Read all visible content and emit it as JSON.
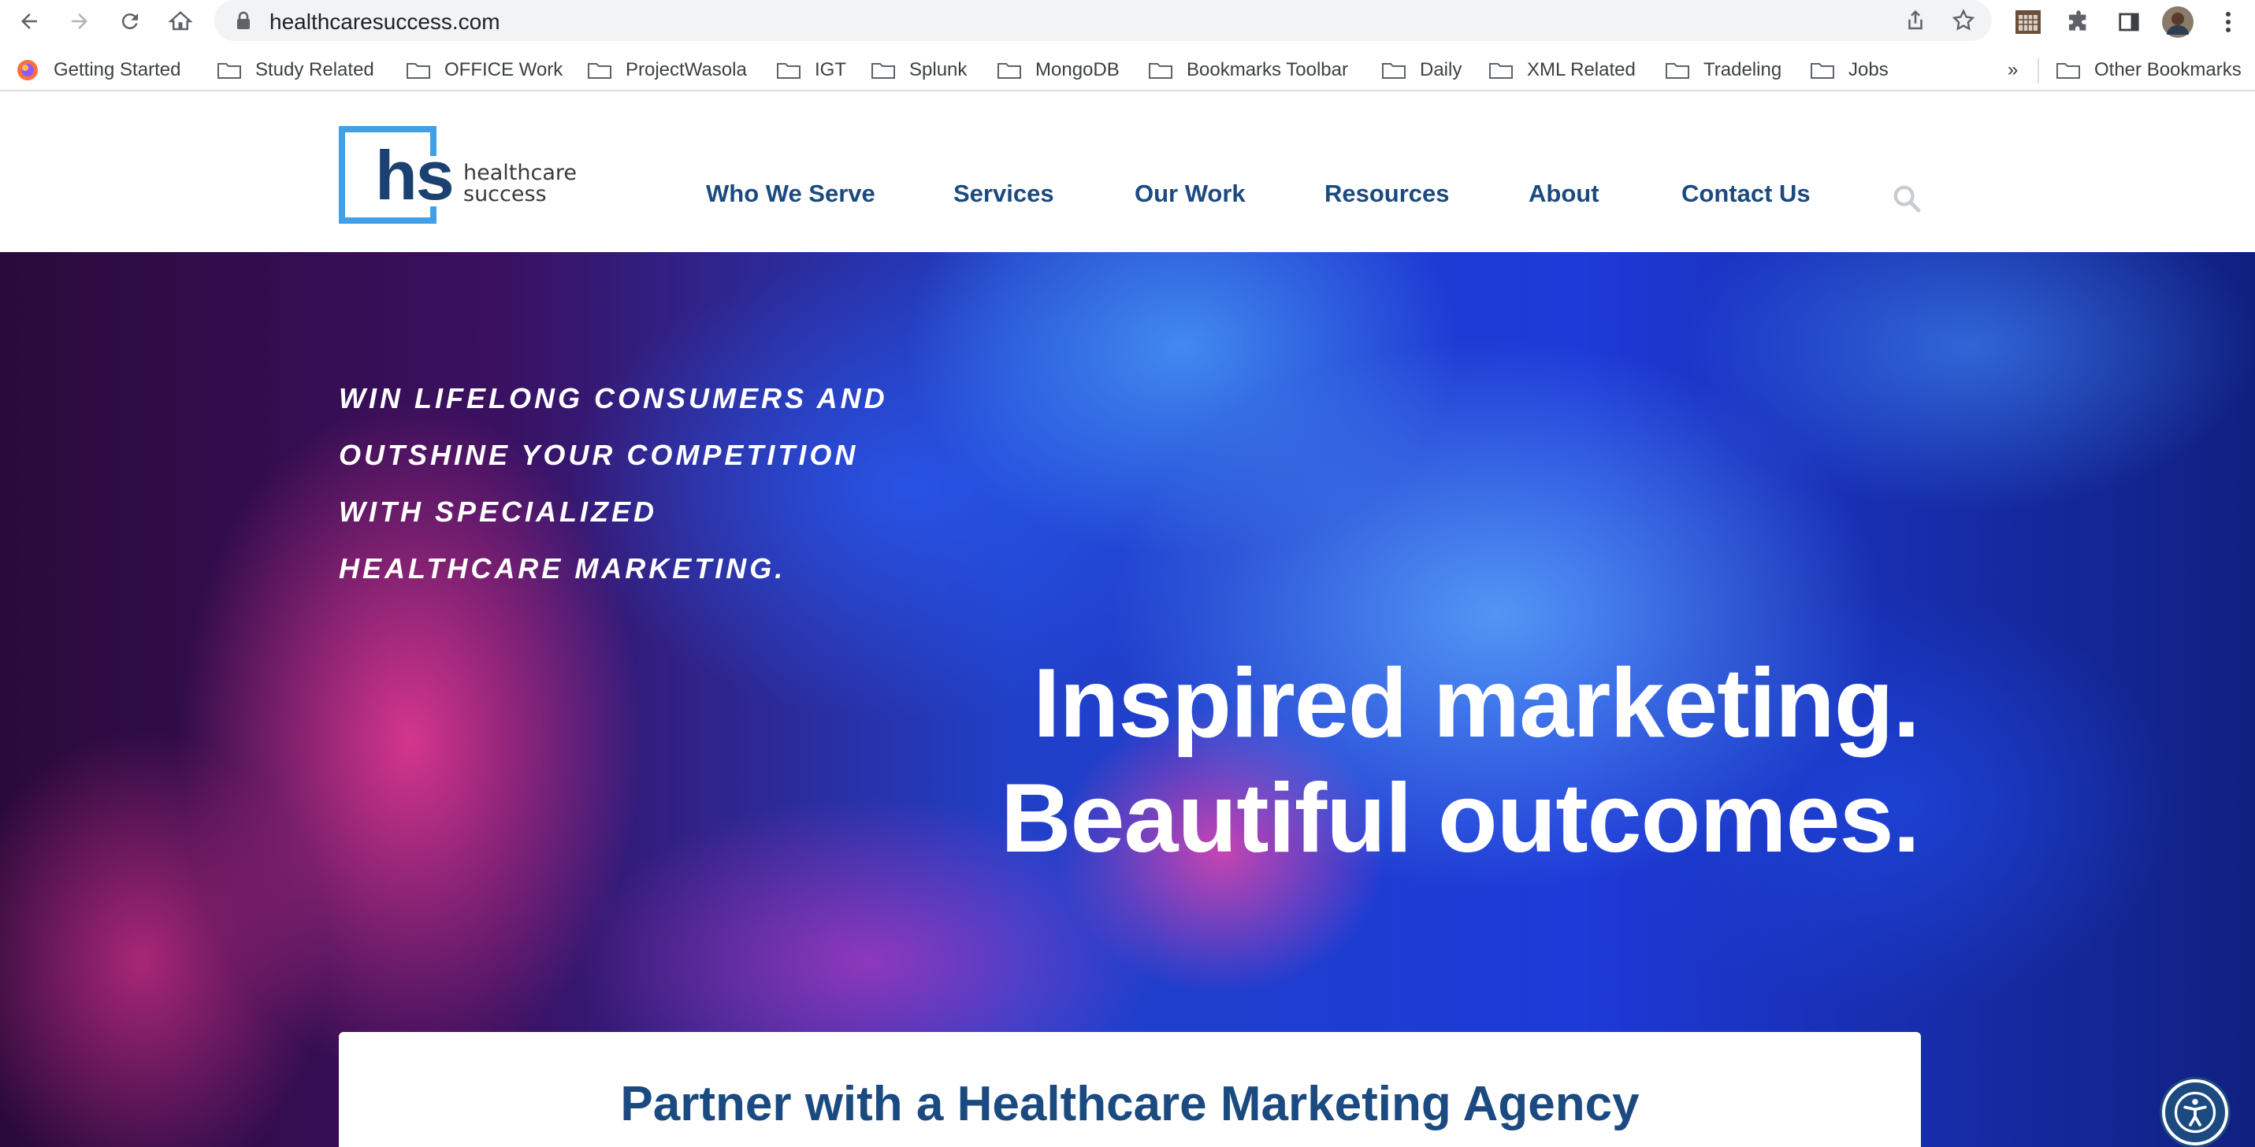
{
  "browser": {
    "url": "healthcaresuccess.com",
    "bookmarks": [
      {
        "label": "Getting Started",
        "icon": "firefox-icon"
      },
      {
        "label": "Study Related",
        "icon": "folder-icon"
      },
      {
        "label": "OFFICE Work",
        "icon": "folder-icon"
      },
      {
        "label": "ProjectWasola",
        "icon": "folder-icon"
      },
      {
        "label": "IGT",
        "icon": "folder-icon"
      },
      {
        "label": "Splunk",
        "icon": "folder-icon"
      },
      {
        "label": "MongoDB",
        "icon": "folder-icon"
      },
      {
        "label": "Bookmarks Toolbar",
        "icon": "folder-icon"
      },
      {
        "label": "Daily",
        "icon": "folder-icon"
      },
      {
        "label": "XML Related",
        "icon": "folder-icon"
      },
      {
        "label": "Tradeling",
        "icon": "folder-icon"
      },
      {
        "label": "Jobs",
        "icon": "folder-icon"
      }
    ],
    "overflow_label": "»",
    "other_bookmarks": "Other Bookmarks"
  },
  "site": {
    "logo": {
      "mark": "hs",
      "line1": "healthcare",
      "line2": "success"
    },
    "nav": [
      "Who We Serve",
      "Services",
      "Our Work",
      "Resources",
      "About",
      "Contact Us"
    ],
    "hero": {
      "tagline": [
        "WIN LIFELONG CONSUMERS AND",
        "OUTSHINE YOUR COMPETITION",
        "WITH SPECIALIZED",
        "HEALTHCARE MARKETING."
      ],
      "headline": [
        "Inspired marketing.",
        "Beautiful outcomes."
      ]
    },
    "partner_title": "Partner with a Healthcare Marketing Agency"
  },
  "colors": {
    "brand_blue": "#1b4a80",
    "logo_blue": "#3fa0e8"
  }
}
